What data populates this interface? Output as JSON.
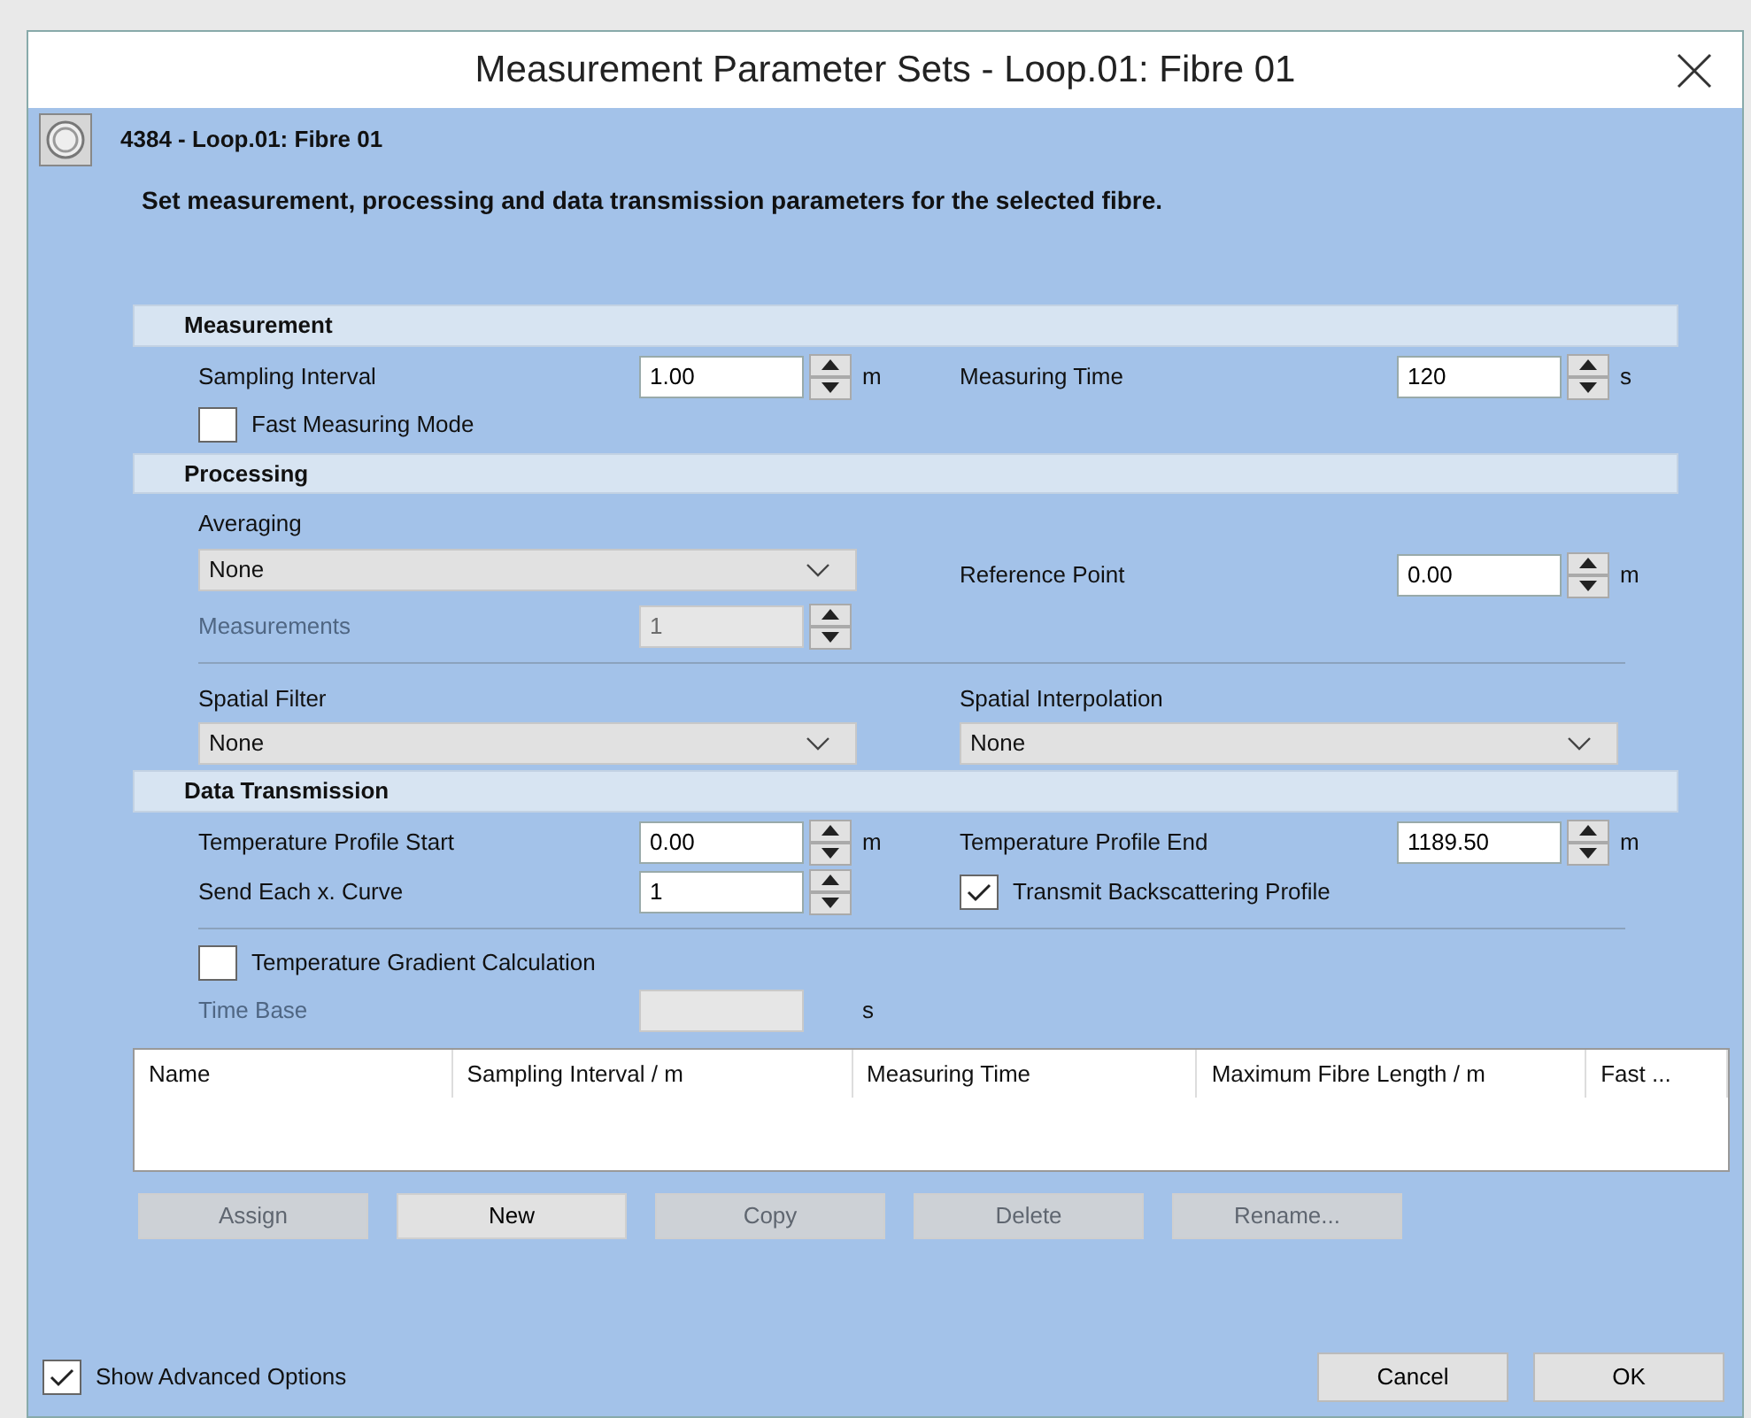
{
  "window": {
    "title": "Measurement Parameter Sets - Loop.01: Fibre 01"
  },
  "header": {
    "title": "4384 - Loop.01: Fibre 01",
    "description": "Set measurement, processing and data transmission parameters for the selected fibre."
  },
  "sections": [
    {
      "title": "Measurement",
      "rows": [
        {
          "kind": "pair",
          "left": [
            {
              "kind": "spin",
              "label": "Sampling Interval",
              "value": "1.00",
              "unit": "m",
              "disabled": false
            }
          ],
          "right": [
            {
              "kind": "spin",
              "label": "Measuring Time",
              "value": "120",
              "unit": "s",
              "disabled": false
            }
          ]
        },
        {
          "kind": "pair",
          "left": [
            {
              "kind": "check",
              "label": "Fast Measuring Mode",
              "checked": false
            }
          ],
          "right": []
        }
      ]
    },
    {
      "title": "Processing",
      "rows": [
        {
          "kind": "pair",
          "left": [
            {
              "kind": "select",
              "label": "Averaging",
              "value": "None"
            },
            {
              "kind": "spin",
              "label": "Measurements",
              "value": "1",
              "disabled": true
            }
          ],
          "right": [
            {
              "kind": "spin",
              "label": "Reference Point",
              "value": "0.00",
              "unit": "m",
              "disabled": false
            }
          ]
        },
        {
          "kind": "divider"
        },
        {
          "kind": "pair",
          "left": [
            {
              "kind": "select",
              "label": "Spatial Filter",
              "value": "None"
            }
          ],
          "right": [
            {
              "kind": "select",
              "label": "Spatial Interpolation",
              "value": "None"
            }
          ]
        }
      ]
    },
    {
      "title": "Data Transmission",
      "rows": [
        {
          "kind": "pair",
          "left": [
            {
              "kind": "spin",
              "label": "Temperature Profile Start",
              "value": "0.00",
              "unit": "m",
              "disabled": false
            }
          ],
          "right": [
            {
              "kind": "spin",
              "label": "Temperature Profile End",
              "value": "1189.50",
              "unit": "m",
              "disabled": false
            }
          ]
        },
        {
          "kind": "pair",
          "left": [
            {
              "kind": "spin",
              "label": "Send Each x. Curve",
              "value": "1",
              "disabled": false
            }
          ],
          "right": [
            {
              "kind": "check",
              "label": "Transmit Backscattering Profile",
              "checked": true
            }
          ]
        },
        {
          "kind": "divider"
        },
        {
          "kind": "pair",
          "left": [
            {
              "kind": "check",
              "label": "Temperature Gradient Calculation",
              "checked": false
            }
          ],
          "right": []
        },
        {
          "kind": "pair",
          "left": [
            {
              "kind": "field",
              "label": "Time Base",
              "unit": "s",
              "disabled": true
            }
          ],
          "right": []
        }
      ]
    }
  ],
  "table": {
    "columns": [
      "Name",
      "Sampling Interval / m",
      "Measuring Time",
      "Maximum Fibre Length / m",
      "Fast ..."
    ]
  },
  "actions": [
    {
      "label": "Assign",
      "disabled": true
    },
    {
      "label": "New",
      "disabled": false
    },
    {
      "label": "Copy",
      "disabled": true
    },
    {
      "label": "Delete",
      "disabled": true
    },
    {
      "label": "Rename...",
      "disabled": true
    }
  ],
  "footer": {
    "advanced": {
      "label": "Show Advanced Options",
      "checked": true
    },
    "buttons": [
      {
        "label": "Cancel"
      },
      {
        "label": "OK"
      }
    ]
  }
}
